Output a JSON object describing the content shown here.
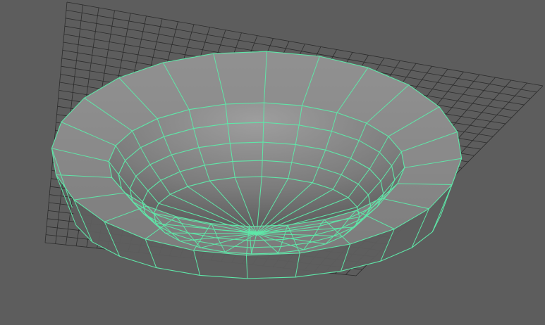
{
  "viewport": {
    "background": "#5d5d5d",
    "grid_color": "#2c2c2c",
    "wire_color": "#5fe6a8",
    "shade_light": "#a8a8a8",
    "shade_mid": "#8a8a8a",
    "shade_dark": "#5e5e5e"
  },
  "mesh": {
    "object": "bowl",
    "radial_segments": 24,
    "display": "shaded-wireframe",
    "selected": true
  }
}
